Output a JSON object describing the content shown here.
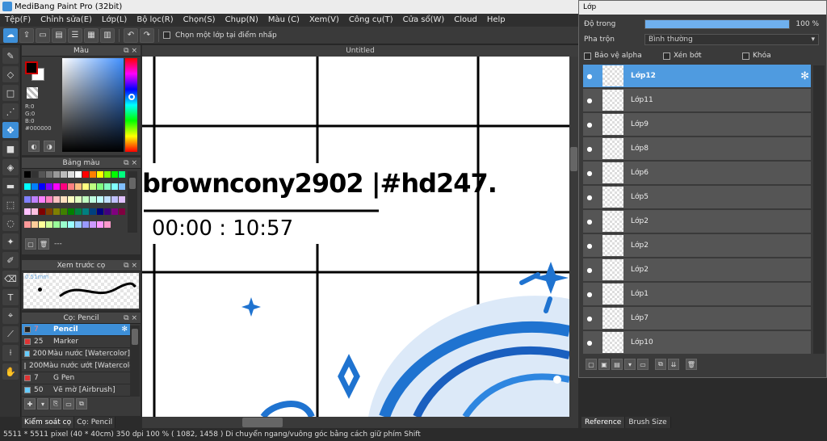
{
  "window": {
    "title": "MediBang Paint Pro (32bit)"
  },
  "menu": [
    "Tệp(F)",
    "Chỉnh sửa(E)",
    "Lớp(L)",
    "Bộ lọc(R)",
    "Chọn(S)",
    "Chụp(N)",
    "Màu (C)",
    "Xem(V)",
    "Công cụ(T)",
    "Cửa sổ(W)",
    "Cloud",
    "Help"
  ],
  "toolbar": {
    "select_layer_label": "Chọn một lớp tại điểm nhấp"
  },
  "color_panel": {
    "title": "Màu",
    "r": "R:0",
    "g": "G:0",
    "b": "B:0",
    "hex": "#000000",
    "primary_color": "#000000",
    "secondary_color": "#ffffff",
    "accent": "#cc0000"
  },
  "palette_panel": {
    "title": "Bảng màu",
    "footer_label": "---",
    "colors": [
      "#000000",
      "#333333",
      "#555555",
      "#777777",
      "#999999",
      "#bbbbbb",
      "#dddddd",
      "#ffffff",
      "#ff0000",
      "#ff7f00",
      "#ffff00",
      "#7fff00",
      "#00ff00",
      "#00ff7f",
      "#00ffff",
      "#007fff",
      "#0000ff",
      "#7f00ff",
      "#ff00ff",
      "#ff007f",
      "#ff8080",
      "#ffbf80",
      "#ffff80",
      "#bfff80",
      "#80ff80",
      "#80ffbf",
      "#80ffff",
      "#80bfff",
      "#8080ff",
      "#bf80ff",
      "#ff80ff",
      "#ff80bf",
      "#ffc0c0",
      "#ffe0c0",
      "#ffffc0",
      "#e0ffc0",
      "#c0ffc0",
      "#c0ffe0",
      "#c0ffff",
      "#c0e0ff",
      "#c0c0ff",
      "#e0c0ff",
      "#ffc0ff",
      "#ffc0e0",
      "#800000",
      "#804000",
      "#808000",
      "#408000",
      "#008000",
      "#008040",
      "#008080",
      "#004080",
      "#000080",
      "#400080",
      "#800080",
      "#800040",
      "#ff9999",
      "#ffcc99",
      "#ffff99",
      "#ccff99",
      "#99ff99",
      "#99ffcc",
      "#99ffff",
      "#99ccff",
      "#9999ff",
      "#cc99ff",
      "#ff99ff",
      "#ff99cc"
    ]
  },
  "preview_panel": {
    "title": "Xem trước cọ",
    "size": "0.51mm"
  },
  "brush_panel": {
    "title": "Cọ: Pencil",
    "items": [
      {
        "size": "7",
        "name": "Pencil",
        "color": "#222222"
      },
      {
        "size": "25",
        "name": "Marker",
        "color": "#dd3333"
      },
      {
        "size": "200",
        "name": "Màu nước [Watercolor]",
        "color": "#66ccff"
      },
      {
        "size": "200",
        "name": "Màu nước ướt [Watercolor]",
        "color": "#66ccff"
      },
      {
        "size": "7",
        "name": "G Pen",
        "color": "#dd3333"
      },
      {
        "size": "50",
        "name": "Vẽ mờ [Airbrush]",
        "color": "#66ccff"
      }
    ]
  },
  "left_tabs": [
    "Kiểm soát cọ",
    "Cọ: Pencil"
  ],
  "document": {
    "tab": "Untitled",
    "drawing_text_1": "browncony2902 |#hd247.",
    "drawing_text_2": "00:00 : 10:57"
  },
  "status": {
    "text": "5511 * 5511 pixel   (40 * 40cm)   350 dpi   100 %   ( 1082, 1458 )   Di chuyển ngang/vuông góc bằng cách giữ phím Shift"
  },
  "layer_window": {
    "title": "Lớp",
    "opacity_label": "Độ trong",
    "opacity_value": "100 %",
    "opacity_fraction": 1.0,
    "blend_label": "Pha trộn",
    "blend_value": "Bình thường",
    "protect_alpha": "Bảo vệ alpha",
    "clipping": "Xén bớt",
    "lock": "Khóa",
    "layers": [
      "Lớp12",
      "Lớp11",
      "Lớp9",
      "Lớp8",
      "Lớp6",
      "Lớp5",
      "Lớp2",
      "Lớp2",
      "Lớp2",
      "Lớp1",
      "Lớp7",
      "Lớp10"
    ]
  },
  "right_tabs": [
    "Reference",
    "Brush Size"
  ]
}
